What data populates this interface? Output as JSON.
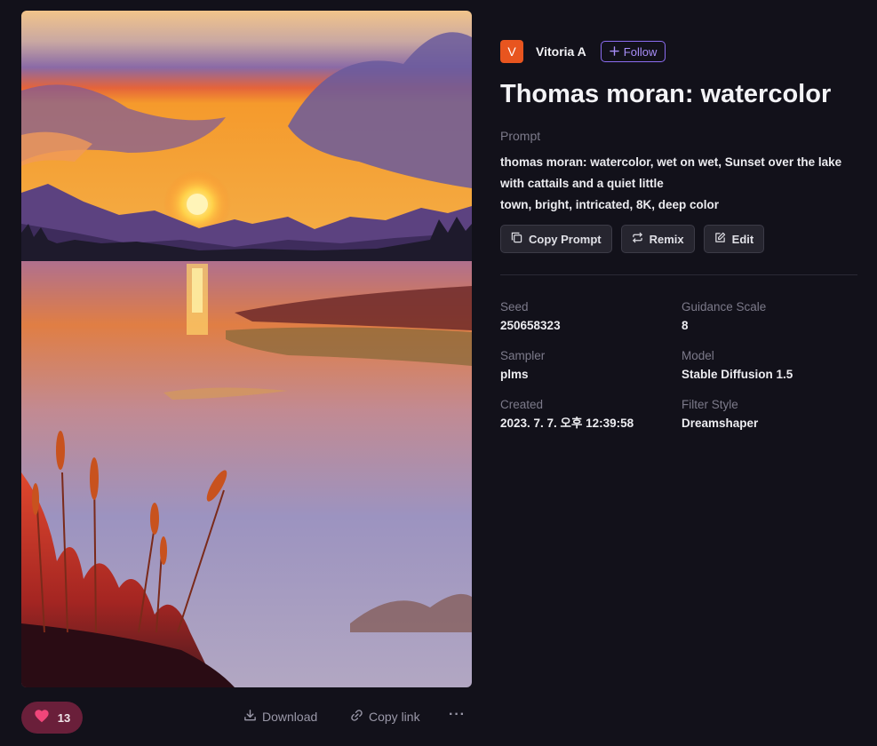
{
  "artwork": {
    "alt": "Thomas moran: watercolor"
  },
  "author": {
    "initial": "V",
    "name": "Vitoria A",
    "follow_label": "Follow"
  },
  "title": "Thomas moran: watercolor",
  "prompt": {
    "label": "Prompt",
    "lines": [
      "thomas moran: watercolor, wet on wet, Sunset over the lake",
      "with cattails and a quiet little",
      "town, bright, intricated, 8K, deep color"
    ]
  },
  "actions": {
    "copy_prompt": "Copy Prompt",
    "remix": "Remix",
    "edit": "Edit"
  },
  "meta": [
    {
      "label": "Seed",
      "value": "250658323"
    },
    {
      "label": "Guidance Scale",
      "value": "8"
    },
    {
      "label": "Sampler",
      "value": "plms"
    },
    {
      "label": "Model",
      "value": "Stable Diffusion 1.5"
    },
    {
      "label": "Created",
      "value": "2023. 7. 7. 오후 12:39:58"
    },
    {
      "label": "Filter Style",
      "value": "Dreamshaper"
    }
  ],
  "footer": {
    "likes": "13",
    "download_label": "Download",
    "copy_link_label": "Copy link",
    "more_label": "···"
  },
  "colors": {
    "background": "#12111a",
    "accent": "#8b6cf0",
    "avatar": "#e8551f",
    "like_bg": "#6a1f3a",
    "heart": "#f0467a"
  },
  "icons": {
    "follow": "plus-icon",
    "copy_prompt": "copy-icon",
    "remix": "repeat-icon",
    "edit": "edit-icon",
    "like": "heart-icon",
    "download": "download-icon",
    "copy_link": "link-icon",
    "more": "more-icon"
  }
}
